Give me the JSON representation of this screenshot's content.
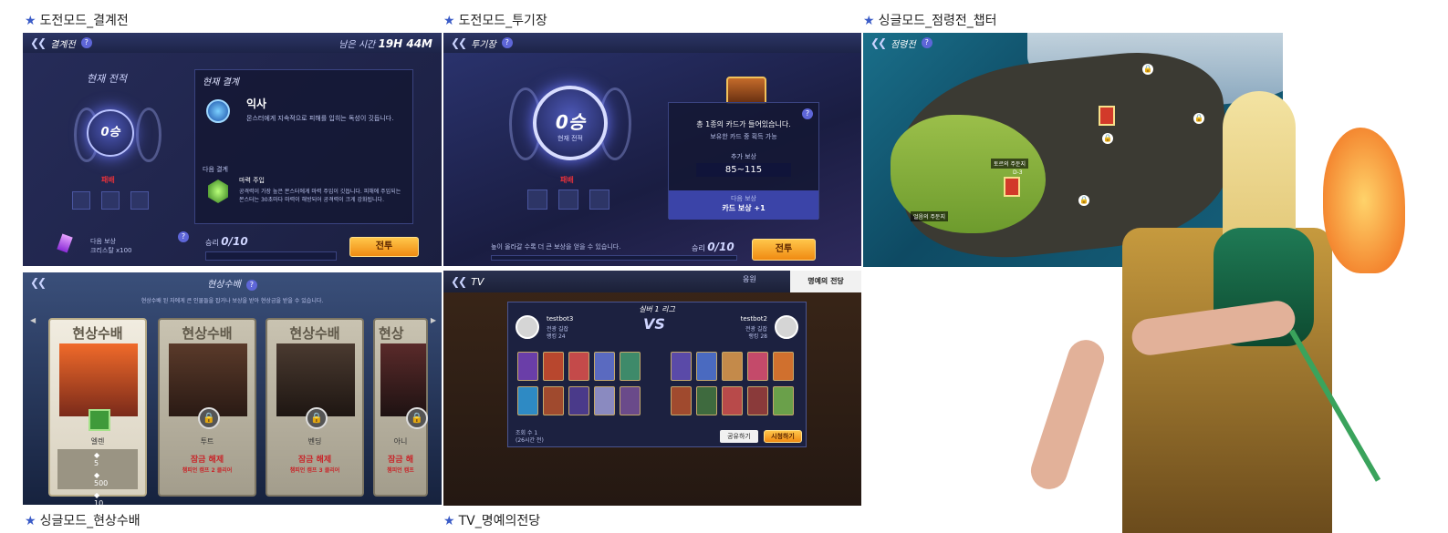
{
  "captions": {
    "battle": "도전모드_결계전",
    "arena": "도전모드_투기장",
    "chapter": "싱글모드_점령전_챕터",
    "bounty": "싱글모드_현상수배",
    "tv": "TV_명예의전당"
  },
  "battle": {
    "title": "결계전",
    "help": "?",
    "remaining_label": "남은 시간",
    "remaining_time": "19H 44M",
    "record_label": "현재 전적",
    "wins": "0승",
    "loss_label": "패배",
    "current_barrier_label": "현재 결계",
    "barrier_name": "익사",
    "barrier_desc": "몬스터에게 지속적으로 피해를 입히는 독성이 깃듭니다.",
    "next_barrier_label": "다음 결계",
    "next_barrier_name": "마력 주입",
    "next_barrier_desc": "공격력이 가장 높은 몬스터에게 마력 주입이 깃듭니다. 피해에 주입되는 몬스터는 30초마다 마력이 해방되어 공격력이 크게 강화됩니다.",
    "reward_label": "다음 보상",
    "reward_item": "크리스탈 x100",
    "win_progress_label": "승리",
    "win_progress": "0/10",
    "battle_button": "전투"
  },
  "arena": {
    "title": "투기장",
    "help": "?",
    "wins": "0승",
    "record_label": "현재 전적",
    "loss_label": "패배",
    "chest_text": "총 1종의 카드가 들어있습니다.",
    "chest_sub": "보유한 카드 중 획득 가능",
    "extra_reward_label": "추가 보상",
    "extra_reward_value": "85~115",
    "next_reward_label": "다음 보상",
    "next_reward_value": "카드 보상 +1",
    "hint": "높이 올라갈 수록 더 큰 보상을 얻을 수 있습니다.",
    "win_progress_label": "승리",
    "win_progress": "0/10",
    "battle_button": "전투"
  },
  "chapter": {
    "title": "점령전",
    "help": "?",
    "map_labels": [
      "토르의 주둔지",
      "D-3",
      "얼음의 주둔지"
    ]
  },
  "bounty": {
    "title": "현상수배",
    "help": "?",
    "subtitle": "현상수배 된 자에게 큰 인물들을 잡거나 보상을 받아 현상금을 받을 수 있습니다.",
    "cards": [
      {
        "title": "현상수배",
        "name": "엘렌",
        "locked": false,
        "rewards": [
          "5",
          "500",
          "10"
        ]
      },
      {
        "title": "현상수배",
        "name": "투트",
        "locked": true,
        "lock_text": "잠금 해제",
        "lock_sub": "챔피언 캠프 2 클리어"
      },
      {
        "title": "현상수배",
        "name": "벤딩",
        "locked": true,
        "lock_text": "잠금 해제",
        "lock_sub": "챔피언 캠프 3 클리어"
      },
      {
        "title": "현상",
        "name": "아니",
        "locked": true,
        "lock_text": "잠금 해",
        "lock_sub": "챔피언 캠프"
      }
    ]
  },
  "tv": {
    "title": "TV",
    "tab_support": "응원",
    "tab_hall": "명예의 전당",
    "league": "실버 1 리그",
    "player1_name": "testbot3",
    "player1_info": [
      "전광 길잡",
      "랭킹 24"
    ],
    "player2_name": "testbot2",
    "player2_info": [
      "전광 길잡",
      "랭킹 28"
    ],
    "vs": "VS",
    "views_label": "조회 수 1",
    "time_label": "(26시간 전)",
    "share_button": "공유하기",
    "watch_button": "시청하기"
  },
  "colors": {
    "caption_star": "#3a5bc7",
    "header_bg": "#2c3565",
    "button_orange": "#f08a12",
    "lock_red": "#c8262a"
  }
}
